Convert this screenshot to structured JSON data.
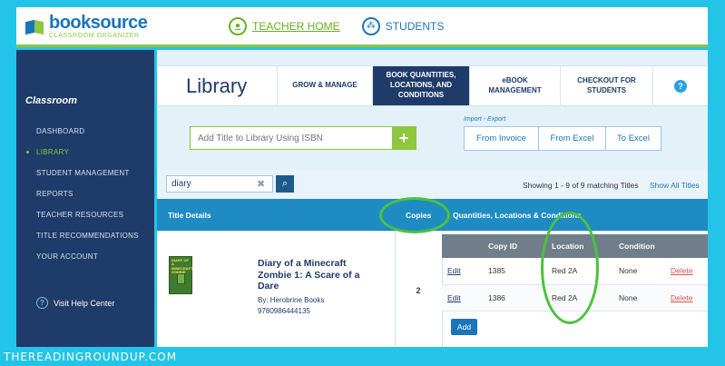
{
  "header": {
    "logo_name": "booksource",
    "logo_sub": "CLASSROOM ORGANIZER",
    "nav": [
      {
        "label": "TEACHER HOME",
        "icon": "apple-icon"
      },
      {
        "label": "STUDENTS",
        "icon": "people-icon"
      }
    ]
  },
  "sidebar": {
    "title": "Classroom",
    "items": [
      {
        "label": "DASHBOARD",
        "active": false
      },
      {
        "label": "LIBRARY",
        "active": true
      },
      {
        "label": "STUDENT MANAGEMENT",
        "active": false
      },
      {
        "label": "REPORTS",
        "active": false
      },
      {
        "label": "TEACHER RESOURCES",
        "active": false
      },
      {
        "label": "TITLE RECOMMENDATIONS",
        "active": false
      },
      {
        "label": "YOUR ACCOUNT",
        "active": false
      }
    ],
    "help": "Visit Help Center",
    "help_icon": "?"
  },
  "main": {
    "page_title": "Library",
    "tabs": [
      {
        "label": "GROW & MANAGE",
        "active": false
      },
      {
        "label": "BOOK QUANTITIES, LOCATIONS, AND CONDITIONS",
        "active": true
      },
      {
        "label": "eBOOK MANAGEMENT",
        "active": false
      },
      {
        "label": "CHECKOUT FOR STUDENTS",
        "active": false
      }
    ],
    "tab_help": "?",
    "isbn_placeholder": "Add Title to Library Using ISBN",
    "isbn_add": "+",
    "import_export_label": "Import - Export",
    "import_export_buttons": [
      "From Invoice",
      "From Excel",
      "To Excel"
    ],
    "search_value": "diary",
    "search_clear": "✖",
    "search_icon": "⌕",
    "showing_text": "Showing 1 - 9 of 9 matching Titles",
    "show_all": "Show All Titles",
    "table_headers": {
      "details": "Title Details",
      "copies": "Copies",
      "qty": "Quantities, Locations & Conditions"
    },
    "book": {
      "cover_text": "DIARY OF A MINECRAFT ZOMBIE",
      "title": "Diary of a Minecraft Zombie 1: A Scare of a Dare",
      "author": "By: Herobrine Books",
      "isbn": "9780986444135",
      "copies": "2"
    },
    "copy_table": {
      "headers": [
        "",
        "Copy ID",
        "Location",
        "Condition",
        ""
      ],
      "rows": [
        {
          "edit": "Edit",
          "copy_id": "1385",
          "location": "Red 2A",
          "condition": "None",
          "delete": "Delete"
        },
        {
          "edit": "Edit",
          "copy_id": "1386",
          "location": "Red 2A",
          "condition": "None",
          "delete": "Delete"
        }
      ],
      "add": "Add"
    }
  },
  "watermark": "THEREADINGROUNDUP.COM",
  "colors": {
    "brand_navy": "#1e3b69",
    "brand_blue": "#1b75bb",
    "brand_green": "#8dc63f",
    "annotation_green": "#4cc23c",
    "delete_red": "#d9534f"
  }
}
